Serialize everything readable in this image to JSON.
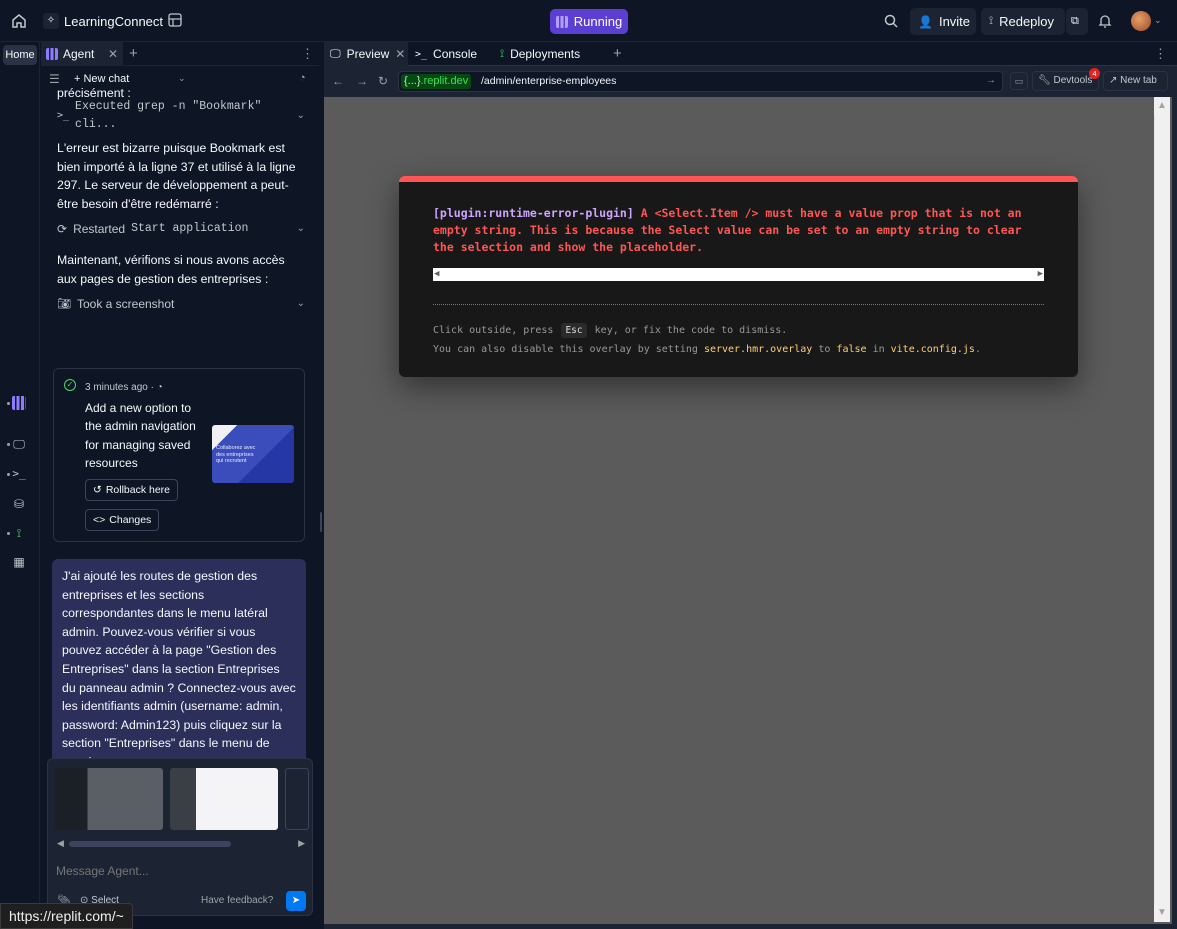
{
  "topbar": {
    "app_title": "LearningConnect",
    "running_label": "Running",
    "invite_label": "Invite",
    "redeploy_label": "Redeploy",
    "icons": [
      "home-icon",
      "replit-logo-icon",
      "workspace-icon",
      "search-icon",
      "user-plus-icon",
      "deploy-icon",
      "copy-icon",
      "bell-icon",
      "avatar"
    ]
  },
  "rail": {
    "home_label": "Home"
  },
  "left": {
    "tab_label": "Agent",
    "new_chat_label": "New chat",
    "texts": {
      "p0": "précisément :",
      "a1": "Executed grep -n \"Bookmark\" cli...",
      "p1": "L'erreur est bizarre puisque Bookmark est bien importé à la ligne 37 et utilisé à la ligne 297. Le serveur de développement a peut-être besoin d'être redémarré :",
      "a2_prefix": "Restarted",
      "a2_mono": "Start application",
      "p2": "Maintenant, vérifions si nous avons accès aux pages de gestion des entreprises :",
      "a3": "Took a screenshot"
    },
    "checkpoint": {
      "time": "3 minutes ago",
      "title": "Add a new option to the admin navigation for managing saved resources",
      "rollback_label": "Rollback here",
      "changes_label": "Changes",
      "thumb_text": "Collaborez avec des entreprises qui recrutent"
    },
    "user_message": "J'ai ajouté les routes de gestion des entreprises et les sections correspondantes dans le menu latéral admin. Pouvez-vous vérifier si vous pouvez accéder à la page \"Gestion des Entreprises\" dans la section Entreprises du panneau admin ? Connectez-vous avec les identifiants admin (username: admin, password: Admin123) puis cliquez sur la section \"Entreprises\" dans le menu de gauche.",
    "composer": {
      "placeholder": "Message Agent...",
      "select_label": "Select",
      "feedback_label": "Have feedback?"
    }
  },
  "status_url": "https://replit.com/~",
  "right": {
    "tabs": [
      {
        "label": "Preview"
      },
      {
        "label": "Console"
      },
      {
        "label": "Deployments"
      }
    ],
    "url": {
      "domain": ".replit.dev",
      "domain_prefix": "{...}",
      "path": "/admin/enterprise-employees"
    },
    "devtools_label": "Devtools",
    "devtools_badge": "4",
    "newtab_label": "New tab",
    "overlay": {
      "plugin": "[plugin:runtime-error-plugin]",
      "message": "A <Select.Item /> must have a value prop that is not an empty string. This is because the Select value can be set to an empty string to clear the selection and show the placeholder.",
      "tip1_a": "Click outside, press",
      "tip1_key": "Esc",
      "tip1_b": "key, or fix the code to dismiss.",
      "tip2_a": "You can also disable this overlay by setting",
      "tip2_code": "server.hmr.overlay",
      "tip2_b": "to",
      "tip2_code2": "false",
      "tip2_c": "in",
      "tip2_code3": "vite.config.js",
      "tip2_end": "."
    }
  },
  "colors": {
    "bg": "#0e1525",
    "panel": "#1c2333",
    "running": "#5b3fd1",
    "user_bubble": "#2d2f5b",
    "error": "#ff5555",
    "send": "#0079f2"
  }
}
